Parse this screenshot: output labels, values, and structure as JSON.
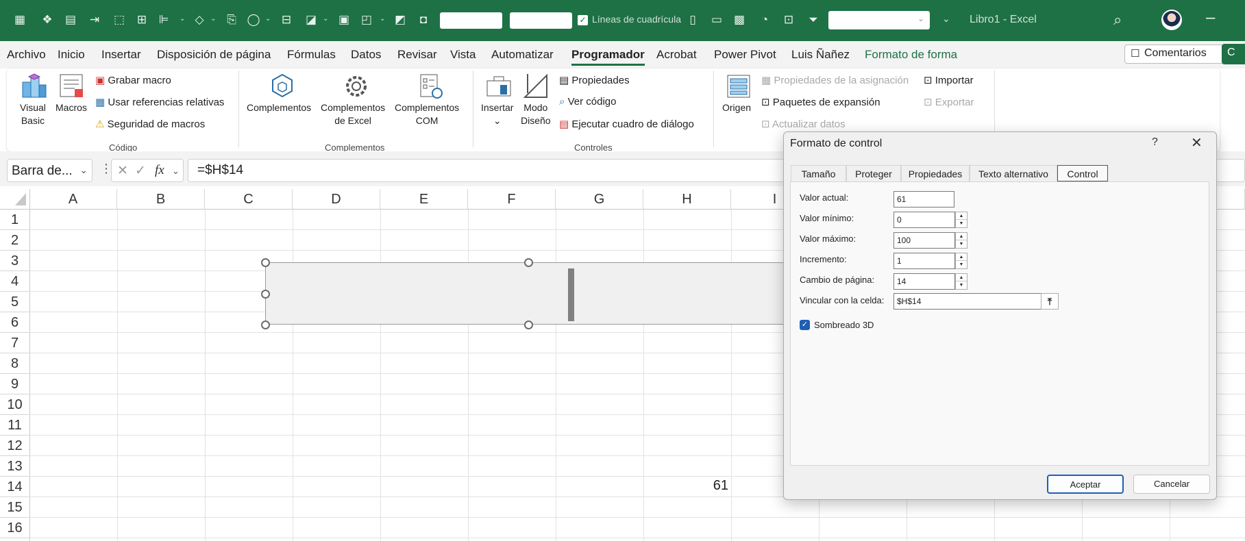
{
  "titlebar": {
    "gridlines_label": "Líneas de cuadrícula",
    "window_title": "Libro1 - Excel",
    "accent": "#1e7145"
  },
  "menubar": {
    "items": [
      "Archivo",
      "Inicio",
      "Insertar",
      "Disposición de página",
      "Fórmulas",
      "Datos",
      "Revisar",
      "Vista",
      "Automatizar",
      "Programador",
      "Acrobat",
      "Power Pivot",
      "Luis Ñañez",
      "Formato de forma"
    ],
    "active": "Programador",
    "comments_label": "Comentarios",
    "share_label": "C"
  },
  "ribbon": {
    "codigo": {
      "visual_basic_l1": "Visual",
      "visual_basic_l2": "Basic",
      "macros": "Macros",
      "grabar_macro": "Grabar macro",
      "usar_referencias": "Usar referencias relativas",
      "seguridad_macros": "Seguridad de macros",
      "group_label": "Código"
    },
    "complementos": {
      "complementos": "Complementos",
      "excel_l1": "Complementos",
      "excel_l2": "de Excel",
      "com_l1": "Complementos",
      "com_l2": "COM",
      "group_label": "Complementos"
    },
    "controles": {
      "insertar": "Insertar",
      "modo_l1": "Modo",
      "modo_l2": "Diseño",
      "propiedades": "Propiedades",
      "ver_codigo": "Ver código",
      "ejecutar_cuadro": "Ejecutar cuadro de diálogo",
      "group_label": "Controles"
    },
    "xml": {
      "origen": "Origen",
      "propiedades_asignacion": "Propiedades de la asignación",
      "paquetes_expansion": "Paquetes de expansión",
      "actualizar_datos": "Actualizar datos",
      "importar": "Importar",
      "exportar": "Exportar"
    }
  },
  "formula_bar": {
    "name_box": "Barra de...",
    "formula": "=$H$14"
  },
  "sheet": {
    "columns": [
      "A",
      "B",
      "C",
      "D",
      "E",
      "F",
      "G",
      "H",
      "I"
    ],
    "rows": [
      "1",
      "2",
      "3",
      "4",
      "5",
      "6",
      "7",
      "8",
      "9",
      "10",
      "11",
      "12",
      "13",
      "14",
      "15",
      "16"
    ],
    "cell_H14": "61"
  },
  "dialog": {
    "title": "Formato de control",
    "help": "?",
    "close": "✕",
    "tabs": [
      "Tamaño",
      "Proteger",
      "Propiedades",
      "Texto alternativo",
      "Control"
    ],
    "active_tab": "Control",
    "fields": {
      "valor_actual_label": "Valor actual:",
      "valor_actual": "61",
      "valor_minimo_label": "Valor mínimo:",
      "valor_minimo": "0",
      "valor_maximo_label": "Valor máximo:",
      "valor_maximo": "100",
      "incremento_label": "Incremento:",
      "incremento": "1",
      "cambio_pagina_label": "Cambio de página:",
      "cambio_pagina": "14",
      "vincular_label": "Vincular con la celda:",
      "vincular": "$H$14"
    },
    "sombreado_label": "Sombreado 3D",
    "sombreado_checked": true,
    "ok": "Aceptar",
    "cancel": "Cancelar"
  }
}
